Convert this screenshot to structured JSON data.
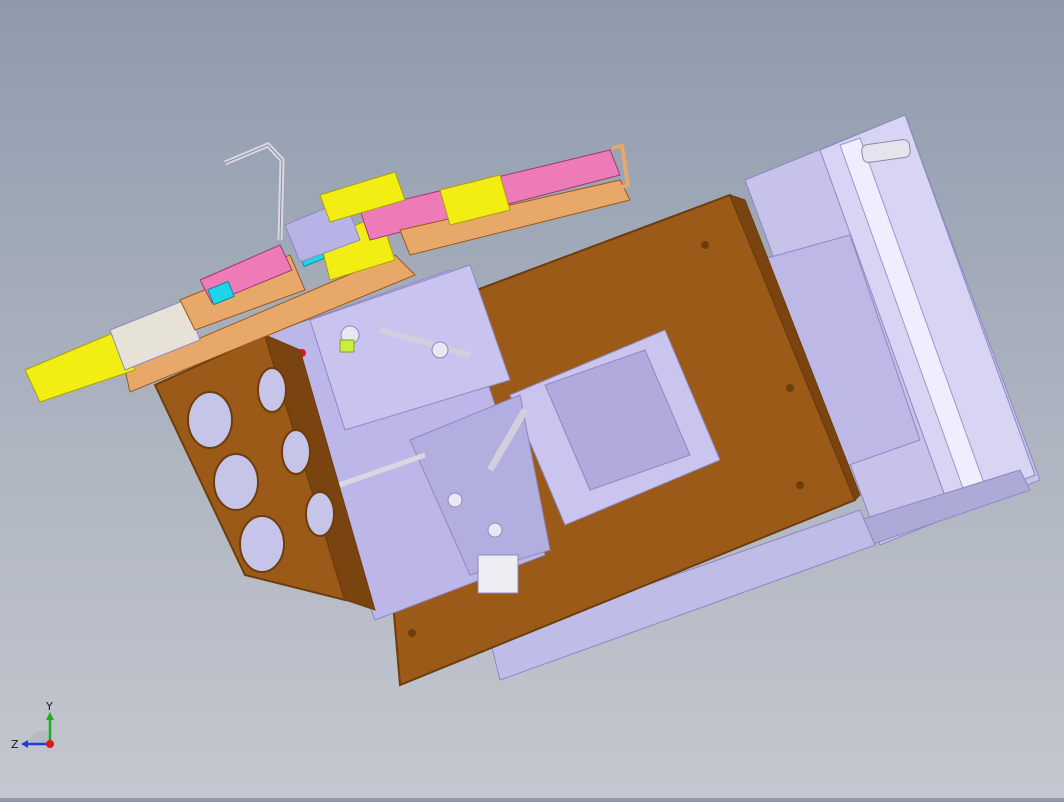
{
  "viewport": {
    "background_top": "#8e9aac",
    "background_bottom": "#c4c7cf"
  },
  "model": {
    "colors": {
      "base_plate": "#9b5a18",
      "base_plate_edge": "#6e3d0c",
      "frame_parts": "#b8b3e6",
      "frame_parts_dark": "#8d88c2",
      "rail": "#d6d3f2",
      "yellow_parts": "#f2ee14",
      "pink_parts": "#ee7ab8",
      "cyan_parts": "#1fd3e8",
      "orange_parts": "#e8a86a",
      "handle": "#d8d8e2"
    }
  },
  "triad": {
    "x_label": "",
    "y_label": "Y",
    "z_label": "Z",
    "y_color": "#19b019",
    "z_color": "#1a3fd8",
    "x_color": "#e01818"
  }
}
